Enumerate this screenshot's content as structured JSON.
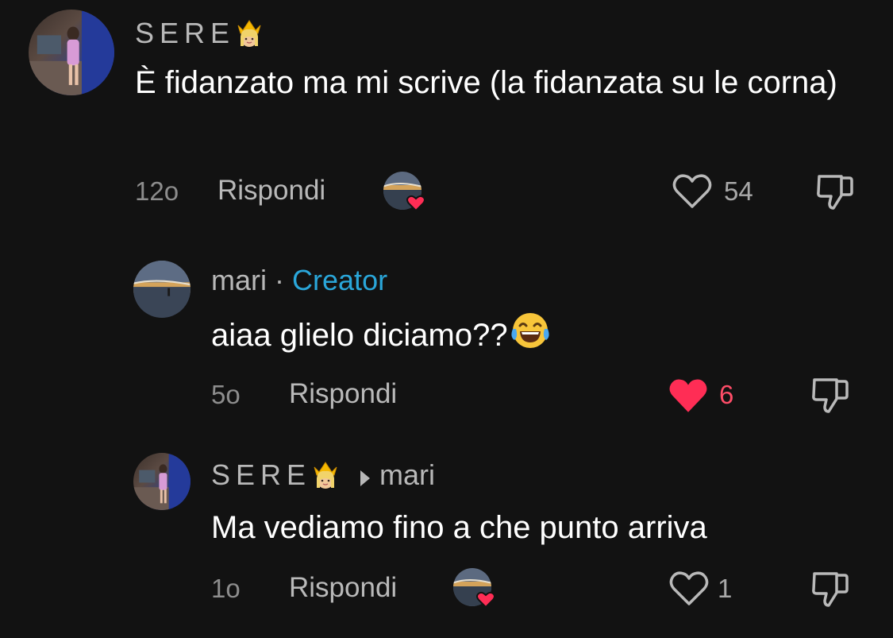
{
  "comments": [
    {
      "username": "SERE",
      "text": "È fidanzato ma mi scrive (la fidanzata su le corna)",
      "time": "12o",
      "reply_label": "Rispondi",
      "likes": "54",
      "liked": false
    },
    {
      "username": "mari",
      "separator": "·",
      "badge": "Creator",
      "text": "aiaa glielo diciamo??",
      "time": "5o",
      "reply_label": "Rispondi",
      "likes": "6",
      "liked": true
    },
    {
      "username": "SERE",
      "reply_to": "mari",
      "text": "Ma vediamo fino a che punto arriva",
      "time": "1o",
      "reply_label": "Rispondi",
      "likes": "1",
      "liked": false
    }
  ],
  "colors": {
    "background": "#121212",
    "creator_badge": "#2aa6d9",
    "liked_heart": "#ff2d55",
    "muted_text": "#8d8d8d"
  },
  "icons": [
    "crown-emoji-icon",
    "laughing-emoji-icon",
    "heart-icon",
    "heart-filled-icon",
    "dislike-icon",
    "creator-liked-avatar-icon",
    "reply-arrow-icon"
  ]
}
